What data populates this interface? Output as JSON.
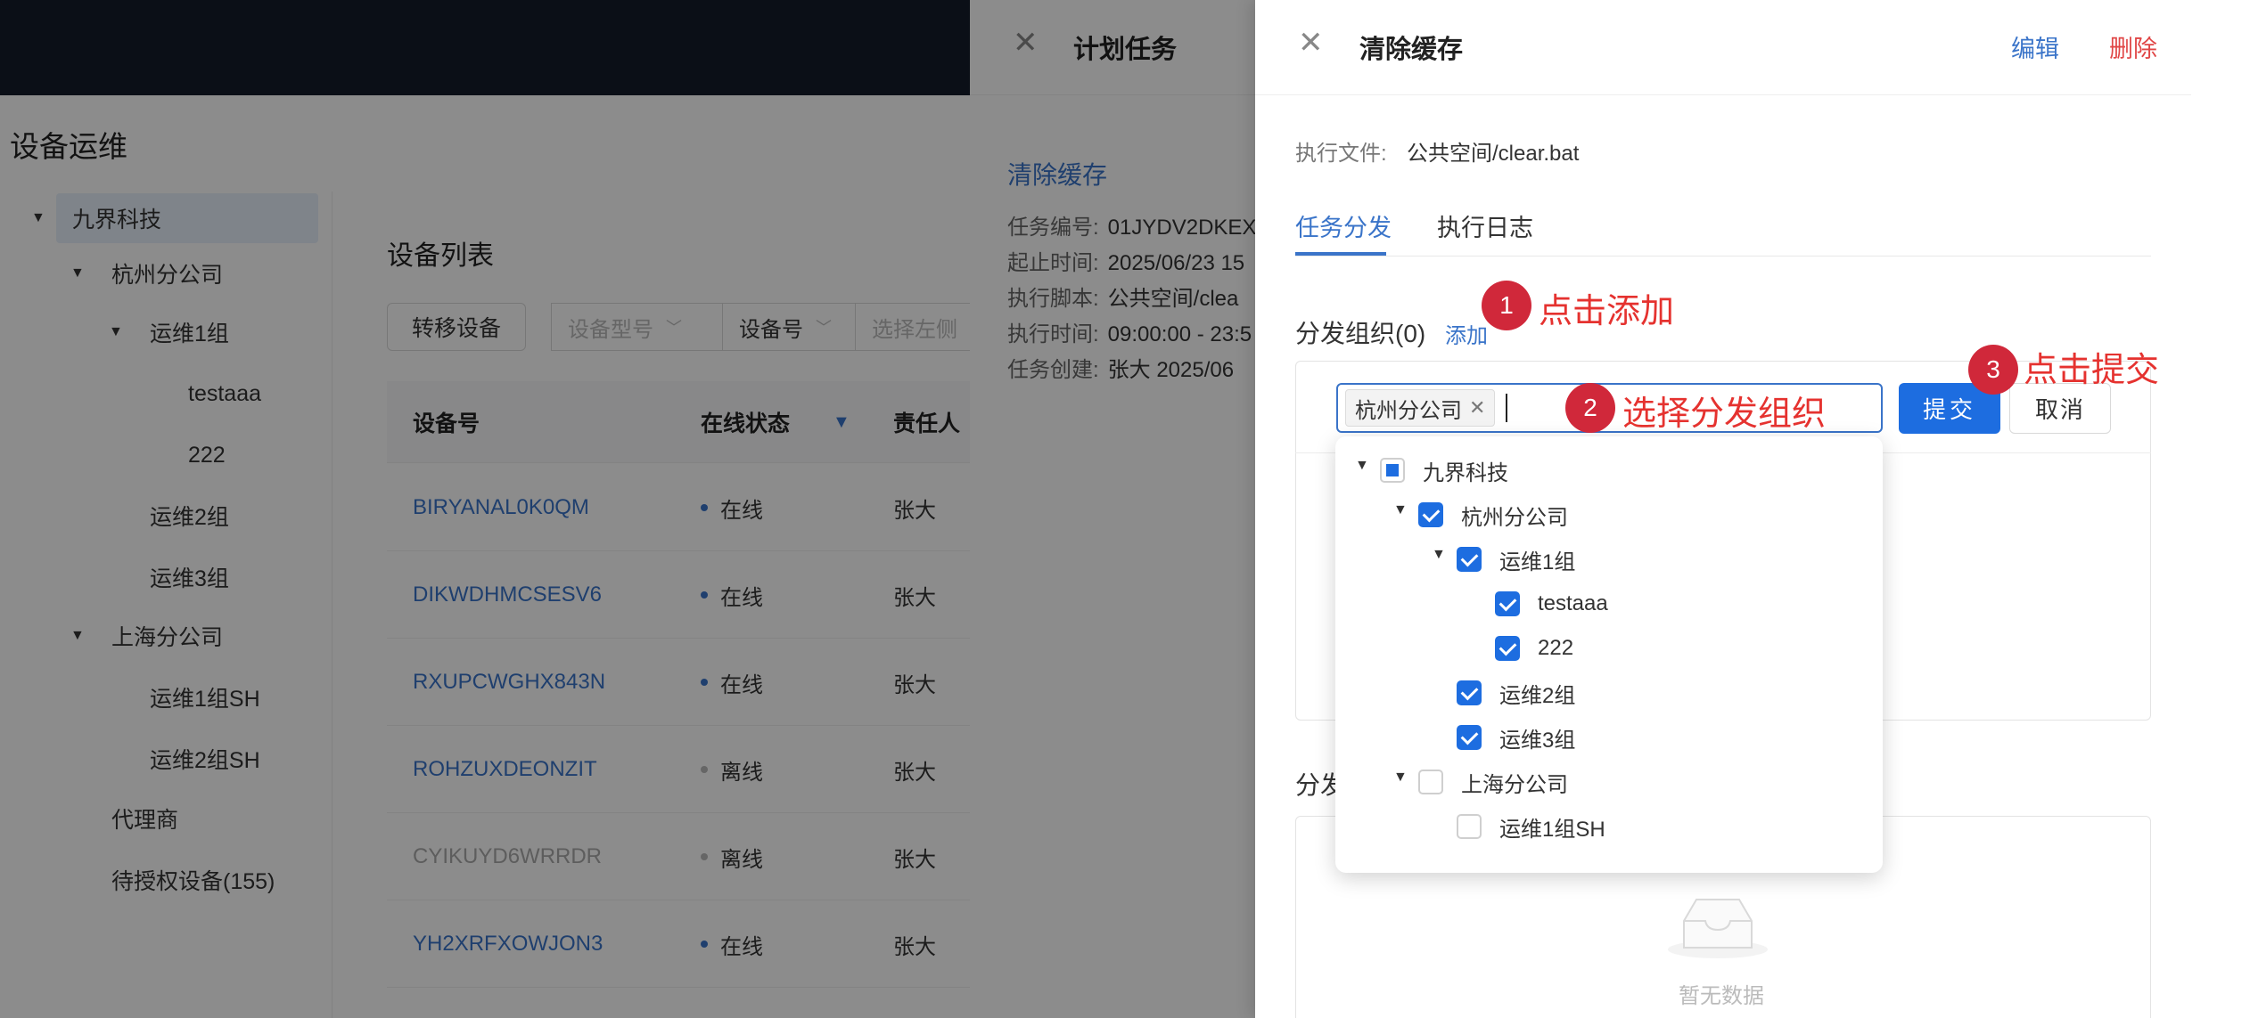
{
  "app": {
    "page_title": "设备运维",
    "org_tree": [
      {
        "label": "九界科技",
        "expanded": true,
        "selected": true
      },
      {
        "label": "杭州分公司",
        "expanded": true
      },
      {
        "label": "运维1组",
        "expanded": true
      },
      {
        "label": "testaaa"
      },
      {
        "label": "222"
      },
      {
        "label": "运维2组"
      },
      {
        "label": "运维3组"
      },
      {
        "label": "上海分公司",
        "expanded": true
      },
      {
        "label": "运维1组SH"
      },
      {
        "label": "运维2组SH"
      },
      {
        "label": "代理商"
      },
      {
        "label": "待授权设备(155)"
      }
    ],
    "device_list": {
      "title": "设备列表",
      "transfer_button": "转移设备",
      "filters": [
        "设备型号",
        "设备号",
        "选择左侧"
      ],
      "columns": [
        "设备号",
        "在线状态",
        "责任人"
      ],
      "rows": [
        {
          "id": "BIRYANAL0K0QM",
          "status": "在线",
          "owner": "张大"
        },
        {
          "id": "DIKWDHMCSESV6",
          "status": "在线",
          "owner": "张大"
        },
        {
          "id": "RXUPCWGHX843N",
          "status": "在线",
          "owner": "张大"
        },
        {
          "id": "ROHZUXDEONZIT",
          "status": "离线",
          "owner": "张大"
        },
        {
          "id": "CYIKUYD6WRRDR",
          "status": "离线",
          "owner": "张大"
        },
        {
          "id": "YH2XRFXOWJON3",
          "status": "在线",
          "owner": "张大"
        }
      ]
    }
  },
  "drawer1": {
    "title": "计划任务",
    "task_name": "清除缓存",
    "info": [
      {
        "k": "任务编号:",
        "v": "01JYDV2DKEX"
      },
      {
        "k": "起止时间:",
        "v": "2025/06/23 15"
      },
      {
        "k": "执行脚本:",
        "v": "公共空间/clea"
      },
      {
        "k": "执行时间:",
        "v": "09:00:00 - 23:5"
      },
      {
        "k": "任务创建:",
        "v": "张大  2025/06"
      }
    ]
  },
  "drawer2": {
    "title": "清除缓存",
    "edit": "编辑",
    "delete": "删除",
    "exec_file_label": "执行文件:",
    "exec_file_value": "公共空间/clear.bat",
    "tabs": [
      "任务分发",
      "执行日志"
    ],
    "dist_org_title": "分发组织(0)",
    "add_link": "添加",
    "selected_tag": "杭州分公司",
    "submit": "提交",
    "cancel": "取消",
    "dist_dev_title": "分发",
    "empty_text": "暂无数据"
  },
  "dropdown_tree": [
    {
      "label": "九界科技",
      "level": 0,
      "state": "partial",
      "expanded": true
    },
    {
      "label": "杭州分公司",
      "level": 1,
      "state": "checked",
      "expanded": true
    },
    {
      "label": "运维1组",
      "level": 2,
      "state": "checked",
      "expanded": true
    },
    {
      "label": "testaaa",
      "level": 3,
      "state": "checked"
    },
    {
      "label": "222",
      "level": 3,
      "state": "checked"
    },
    {
      "label": "运维2组",
      "level": 2,
      "state": "checked"
    },
    {
      "label": "运维3组",
      "level": 2,
      "state": "checked"
    },
    {
      "label": "上海分公司",
      "level": 1,
      "state": "unchecked",
      "expanded": true
    },
    {
      "label": "运维1组SH",
      "level": 2,
      "state": "unchecked"
    }
  ],
  "annotations": [
    {
      "num": "1",
      "text": "点击添加"
    },
    {
      "num": "2",
      "text": "选择分发组织"
    },
    {
      "num": "3",
      "text": "点击提交"
    }
  ],
  "colors": {
    "primary": "#1d6de0",
    "link": "#3a74c9",
    "danger": "#e04646",
    "annotation": "#e5322f",
    "online_dot": "#3a74c9",
    "offline_dot": "#bbbbbb"
  }
}
